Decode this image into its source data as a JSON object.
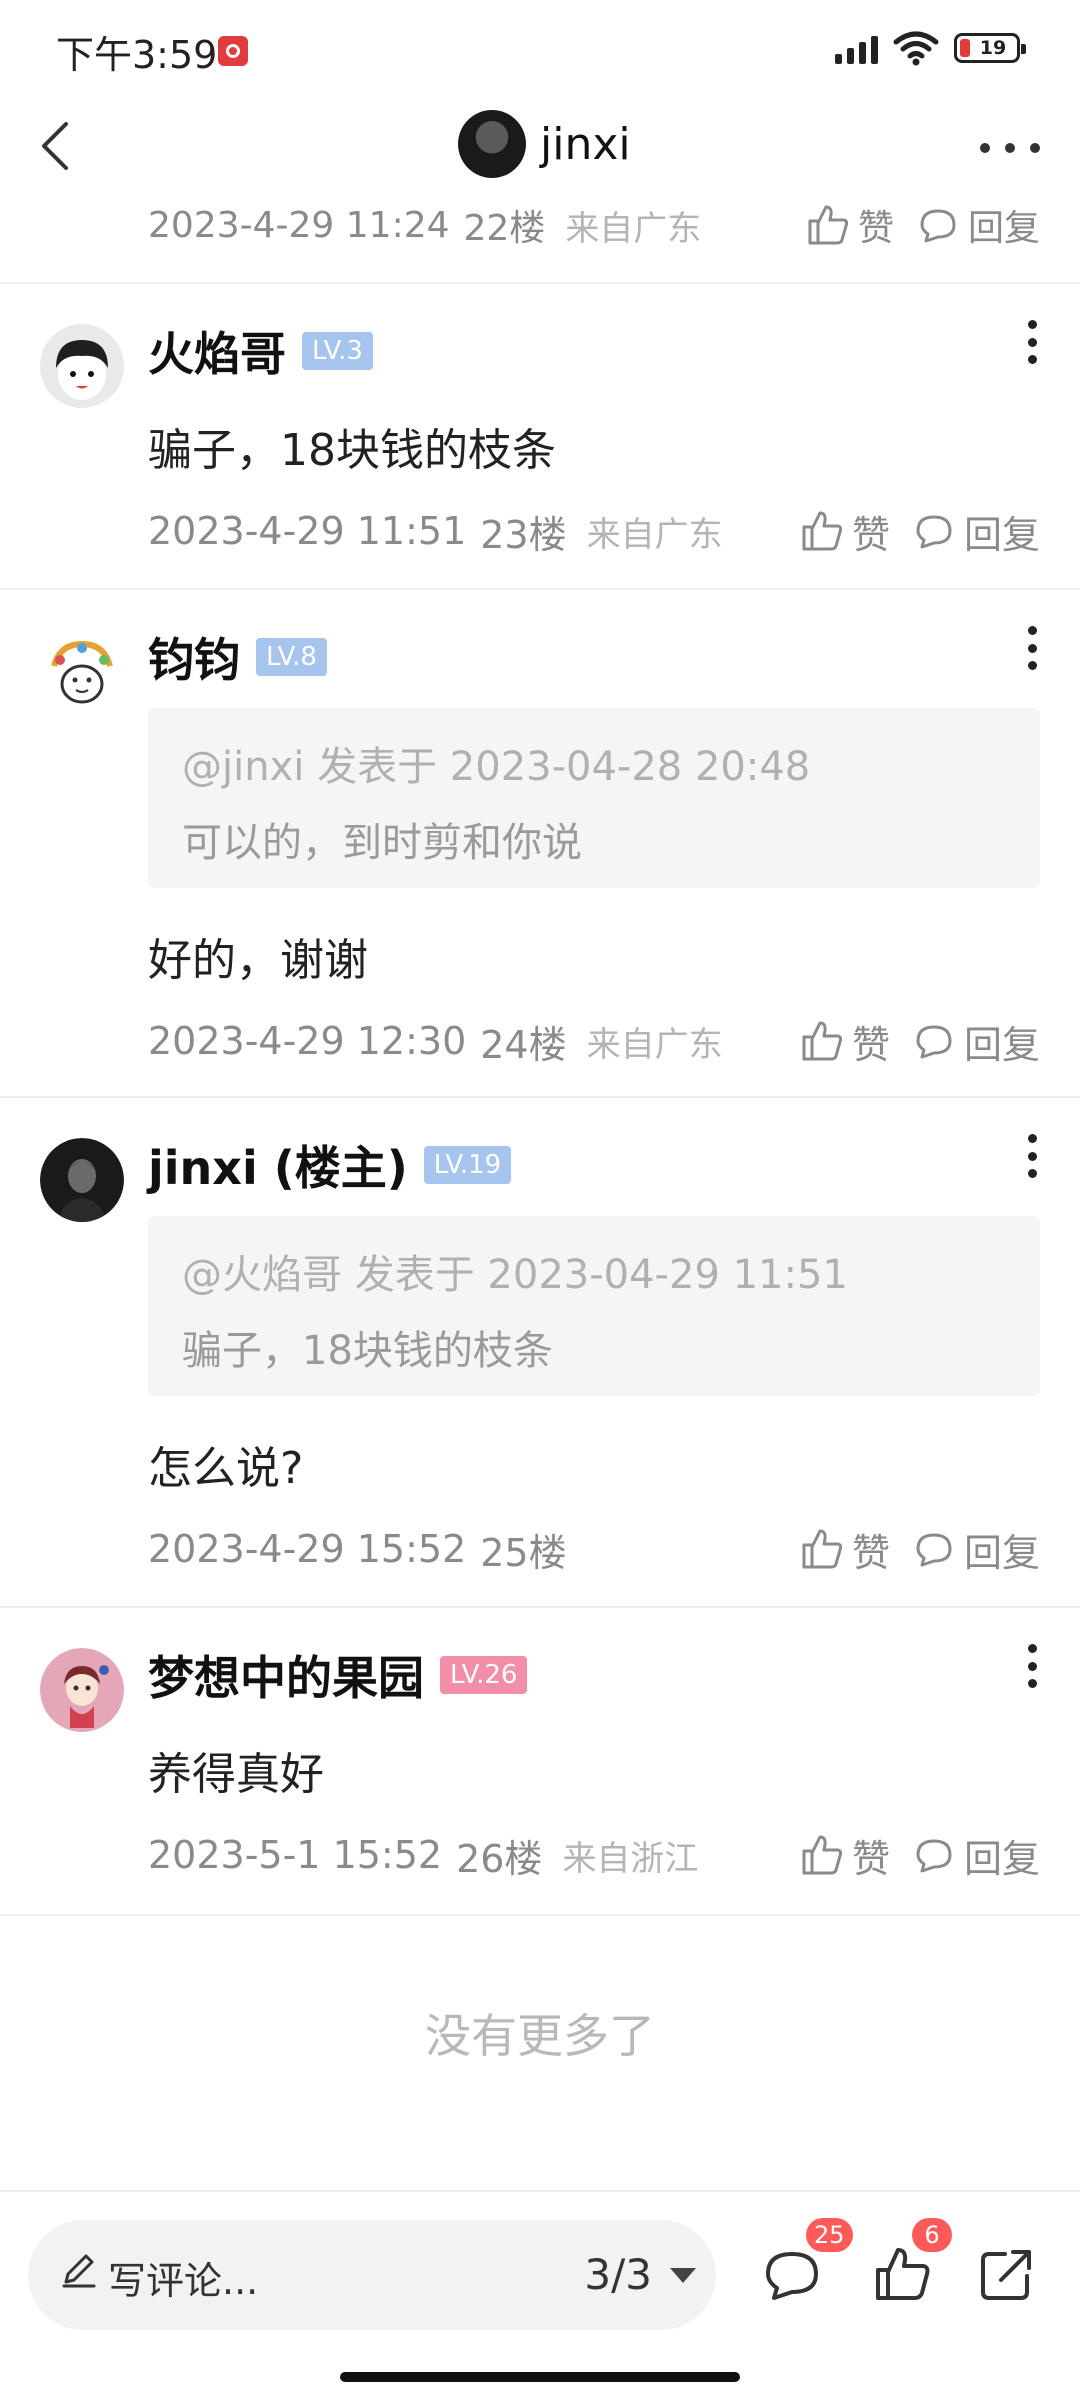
{
  "status_bar": {
    "time": "下午3:59",
    "battery": "19"
  },
  "header": {
    "name": "jinxi"
  },
  "top_partial": {
    "date": "2023-4-29 11:24",
    "floor": "22楼",
    "location": "来自广东",
    "like_label": "赞",
    "reply_label": "回复"
  },
  "comments": [
    {
      "name": "火焰哥",
      "level": "LV.3",
      "text": "骗子，18块钱的枝条",
      "date": "2023-4-29 11:51",
      "floor": "23楼",
      "location": "来自广东",
      "like_label": "赞",
      "reply_label": "回复"
    },
    {
      "name": "钧钧",
      "level": "LV.8",
      "quote_head": "@jinxi 发表于 2023-04-28 20:48",
      "quote_text": "可以的，到时剪和你说",
      "text": "好的，谢谢",
      "date": "2023-4-29 12:30",
      "floor": "24楼",
      "location": "来自广东",
      "like_label": "赞",
      "reply_label": "回复"
    },
    {
      "name": "jinxi (楼主)",
      "level": "LV.19",
      "quote_head": "@火焰哥 发表于 2023-04-29 11:51",
      "quote_text": "骗子，18块钱的枝条",
      "text": "怎么说?",
      "date": "2023-4-29 15:52",
      "floor": "25楼",
      "like_label": "赞",
      "reply_label": "回复"
    },
    {
      "name": "梦想中的果园",
      "level": "LV.26",
      "text": "养得真好",
      "date": "2023-5-1 15:52",
      "floor": "26楼",
      "location": "来自浙江",
      "like_label": "赞",
      "reply_label": "回复"
    }
  ],
  "end_text": "没有更多了",
  "bottom_bar": {
    "placeholder": "写评论...",
    "page": "3/3",
    "comment_count": "25",
    "like_count": "6"
  },
  "colors": {
    "lv_blue": "#a7c4ee",
    "lv_pink": "#f28ea7",
    "badge_red": "#ff5a5a",
    "meta_gray": "#8a8a8a"
  },
  "icons": [
    "back-icon",
    "more-icon",
    "thumb-up-icon",
    "comment-bubble-icon",
    "pen-icon",
    "share-icon",
    "kebab-icon",
    "signal-icon",
    "wifi-icon",
    "battery-icon"
  ]
}
